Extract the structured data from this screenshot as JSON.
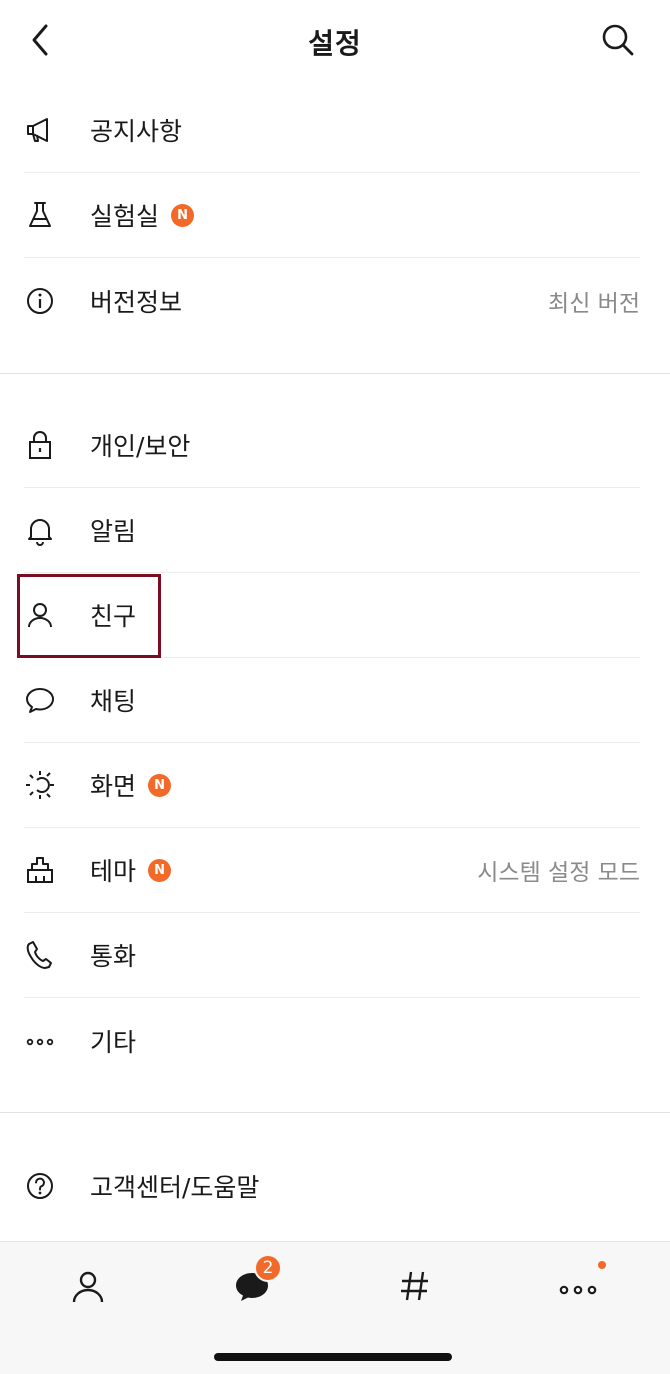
{
  "header": {
    "title": "설정",
    "back_icon": "chevron-left-icon",
    "search_icon": "search-icon"
  },
  "section1": [
    {
      "id": "notice",
      "label": "공지사항",
      "icon": "megaphone-icon"
    },
    {
      "id": "lab",
      "label": "실험실",
      "icon": "flask-icon",
      "badge": "N"
    },
    {
      "id": "version",
      "label": "버전정보",
      "icon": "info-icon",
      "value": "최신 버전"
    }
  ],
  "section2": [
    {
      "id": "privacy",
      "label": "개인/보안",
      "icon": "lock-icon"
    },
    {
      "id": "alarm",
      "label": "알림",
      "icon": "bell-icon"
    },
    {
      "id": "friends",
      "label": "친구",
      "icon": "person-icon"
    },
    {
      "id": "chat",
      "label": "채팅",
      "icon": "chat-bubble-icon"
    },
    {
      "id": "display",
      "label": "화면",
      "icon": "sun-icon",
      "badge": "N"
    },
    {
      "id": "theme",
      "label": "테마",
      "icon": "brush-icon",
      "badge": "N",
      "value": "시스템 설정 모드"
    },
    {
      "id": "call",
      "label": "통화",
      "icon": "phone-icon"
    },
    {
      "id": "etc",
      "label": "기타",
      "icon": "more-dots-icon"
    }
  ],
  "section3": [
    {
      "id": "help",
      "label": "고객센터/도움말",
      "icon": "help-circle-icon"
    }
  ],
  "tabbar": {
    "friends_icon": "person-tab-icon",
    "chats_icon": "chat-tab-icon",
    "chats_badge": "2",
    "openchat_icon": "hashtag-tab-icon",
    "more_icon": "more-tab-icon"
  },
  "colors": {
    "accent": "#f26a2a",
    "highlight_border": "#7a0d21",
    "value_text": "#8a8a8a"
  }
}
